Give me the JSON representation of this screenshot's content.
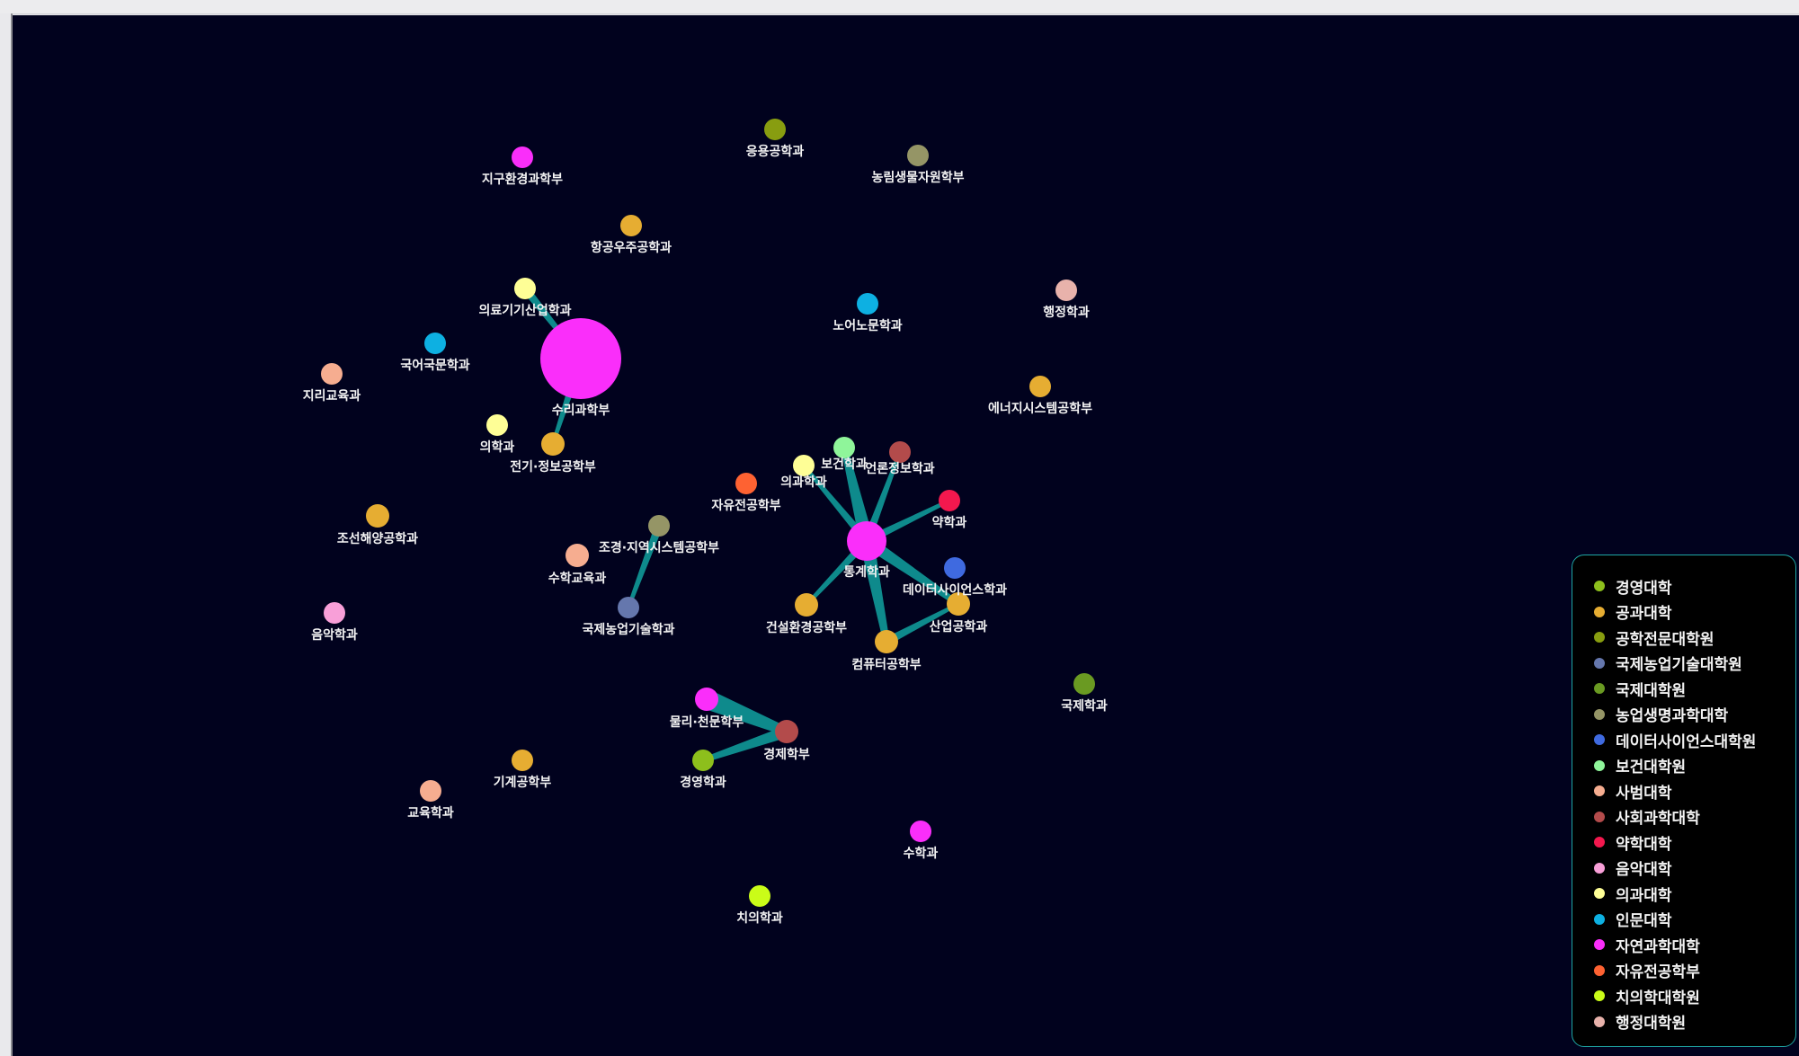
{
  "graph": {
    "edge_color": "#0e8a8c",
    "background": "#01021e",
    "nodes": [
      {
        "id": "n1",
        "label": "지구환경과학부",
        "college": "자연과학대학"
      },
      {
        "id": "n2",
        "label": "응용공학과",
        "college": "공학전문대학원"
      },
      {
        "id": "n3",
        "label": "농림생물자원학부",
        "college": "농업생명과학대학"
      },
      {
        "id": "n4",
        "label": "항공우주공학과",
        "college": "공과대학"
      },
      {
        "id": "n5",
        "label": "의료기기산업학과",
        "college": "의과대학"
      },
      {
        "id": "n6",
        "label": "노어노문학과",
        "college": "인문대학"
      },
      {
        "id": "n7",
        "label": "행정학과",
        "college": "행정대학원"
      },
      {
        "id": "n8",
        "label": "국어국문학과",
        "college": "인문대학"
      },
      {
        "id": "n9",
        "label": "지리교육과",
        "college": "사범대학"
      },
      {
        "id": "n10",
        "label": "수리과학부",
        "college": "자연과학대학"
      },
      {
        "id": "n11",
        "label": "에너지시스템공학부",
        "college": "공과대학"
      },
      {
        "id": "n12",
        "label": "의학과",
        "college": "의과대학"
      },
      {
        "id": "n13",
        "label": "전기·정보공학부",
        "college": "공과대학"
      },
      {
        "id": "n14",
        "label": "보건학과",
        "college": "보건대학원"
      },
      {
        "id": "n15",
        "label": "언론정보학과",
        "college": "사회과학대학"
      },
      {
        "id": "n16",
        "label": "의과학과",
        "college": "의과대학"
      },
      {
        "id": "n17",
        "label": "자유전공학부",
        "college": "자유전공학부"
      },
      {
        "id": "n18",
        "label": "약학과",
        "college": "약학대학"
      },
      {
        "id": "n19",
        "label": "조선해양공학과",
        "college": "공과대학"
      },
      {
        "id": "n20",
        "label": "조경·지역시스템공학부",
        "college": "농업생명과학대학"
      },
      {
        "id": "n21",
        "label": "통계학과",
        "college": "자연과학대학"
      },
      {
        "id": "n22",
        "label": "수학교육과",
        "college": "사범대학"
      },
      {
        "id": "n23",
        "label": "데이터사이언스학과",
        "college": "데이터사이언스대학원"
      },
      {
        "id": "n24",
        "label": "건설환경공학부",
        "college": "공과대학"
      },
      {
        "id": "n25",
        "label": "산업공학과",
        "college": "공과대학"
      },
      {
        "id": "n26",
        "label": "음악학과",
        "college": "음악대학"
      },
      {
        "id": "n27",
        "label": "국제농업기술학과",
        "college": "국제농업기술대학원"
      },
      {
        "id": "n28",
        "label": "컴퓨터공학부",
        "college": "공과대학"
      },
      {
        "id": "n29",
        "label": "국제학과",
        "college": "국제대학원"
      },
      {
        "id": "n30",
        "label": "물리·천문학부",
        "college": "자연과학대학"
      },
      {
        "id": "n31",
        "label": "경제학부",
        "college": "사회과학대학"
      },
      {
        "id": "n32",
        "label": "기계공학부",
        "college": "공과대학"
      },
      {
        "id": "n33",
        "label": "경영학과",
        "college": "경영대학"
      },
      {
        "id": "n34",
        "label": "교육학과",
        "college": "사범대학"
      },
      {
        "id": "n35",
        "label": "수학과",
        "college": "자연과학대학"
      },
      {
        "id": "n36",
        "label": "치의학과",
        "college": "치의학대학원"
      }
    ],
    "edges": [
      {
        "source": "n5",
        "target": "n10"
      },
      {
        "source": "n10",
        "target": "n13"
      },
      {
        "source": "n21",
        "target": "n14"
      },
      {
        "source": "n21",
        "target": "n15"
      },
      {
        "source": "n21",
        "target": "n16"
      },
      {
        "source": "n21",
        "target": "n18"
      },
      {
        "source": "n21",
        "target": "n24"
      },
      {
        "source": "n21",
        "target": "n25"
      },
      {
        "source": "n21",
        "target": "n28"
      },
      {
        "source": "n28",
        "target": "n25"
      },
      {
        "source": "n20",
        "target": "n27"
      },
      {
        "source": "n30",
        "target": "n31"
      },
      {
        "source": "n31",
        "target": "n33"
      }
    ]
  },
  "legend": {
    "items": [
      {
        "label": "경영대학",
        "color": "#8dbf1c"
      },
      {
        "label": "공과대학",
        "color": "#e6ad32"
      },
      {
        "label": "공학전문대학원",
        "color": "#889d10"
      },
      {
        "label": "국제농업기술대학원",
        "color": "#6577ad"
      },
      {
        "label": "국제대학원",
        "color": "#6a9a22"
      },
      {
        "label": "농업생명과학대학",
        "color": "#959566"
      },
      {
        "label": "데이터사이언스대학원",
        "color": "#3f6ae0"
      },
      {
        "label": "보건대학원",
        "color": "#8ff59a"
      },
      {
        "label": "사범대학",
        "color": "#f6ad90"
      },
      {
        "label": "사회과학대학",
        "color": "#b34b4b"
      },
      {
        "label": "약학대학",
        "color": "#f3184e"
      },
      {
        "label": "음악대학",
        "color": "#f89fd8"
      },
      {
        "label": "의과대학",
        "color": "#fefe96"
      },
      {
        "label": "인문대학",
        "color": "#0db0e2"
      },
      {
        "label": "자연과학대학",
        "color": "#fa2efa"
      },
      {
        "label": "자유전공학부",
        "color": "#fe6232"
      },
      {
        "label": "치의학대학원",
        "color": "#cafc18"
      },
      {
        "label": "행정대학원",
        "color": "#e8b2ab"
      }
    ]
  }
}
